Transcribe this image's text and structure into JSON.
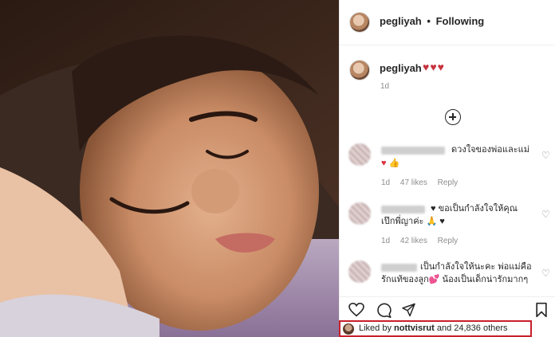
{
  "post": {
    "username": "pegliyah",
    "separator": "•",
    "follow_status": "Following"
  },
  "caption": {
    "username": "pegliyah",
    "hearts": "♥♥♥",
    "time": "1d"
  },
  "comments": [
    {
      "text": "ดวงใจของพ่อและแม่",
      "emoji": "♥ 👍",
      "time": "1d",
      "likes": "47 likes",
      "reply": "Reply"
    },
    {
      "text": "♥ ขอเป็นกำลังใจให้คุณ",
      "text2": "เป๊กพี่ญาค่ะ 🙏 ♥",
      "time": "1d",
      "likes": "42 likes",
      "reply": "Reply"
    },
    {
      "text": "เป็นกำลังใจให้นะคะ พ่อแม่คือ",
      "text2": "รักแท้ของลูก💕 น้องเป็นเด็กน่ารักมากๆ"
    }
  ],
  "likes": {
    "prefix": "Liked by",
    "user": "nottvisrut",
    "suffix": "and 24,836 others"
  },
  "colors": {
    "heart_red": "#d8303c",
    "highlight_box": "#c8202a",
    "meta_gray": "#8e8e8e"
  },
  "icons": [
    "plus-circle-icon",
    "heart-outline-icon",
    "comment-icon",
    "share-icon",
    "bookmark-icon"
  ]
}
